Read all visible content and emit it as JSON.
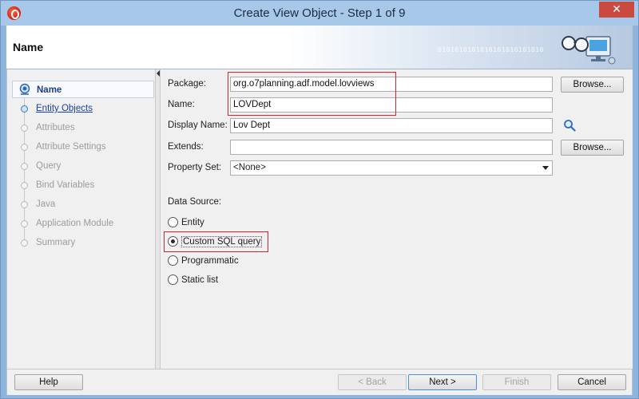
{
  "window": {
    "title": "Create View Object - Step 1 of 9",
    "close_glyph": "✕",
    "header_title": "Name",
    "binary_text": "0101010101010101010101010",
    "app_icon": "oracle-jdeveloper-icon"
  },
  "nav": {
    "items": [
      {
        "label": "Name",
        "state": "active"
      },
      {
        "label": "Entity Objects",
        "state": "link"
      },
      {
        "label": "Attributes",
        "state": "disabled"
      },
      {
        "label": "Attribute Settings",
        "state": "disabled"
      },
      {
        "label": "Query",
        "state": "disabled"
      },
      {
        "label": "Bind Variables",
        "state": "disabled"
      },
      {
        "label": "Java",
        "state": "disabled"
      },
      {
        "label": "Application Module",
        "state": "disabled"
      },
      {
        "label": "Summary",
        "state": "disabled"
      }
    ]
  },
  "form": {
    "package_label": "Package:",
    "package_value": "org.o7planning.adf.model.lovviews",
    "name_label": "Name:",
    "name_value": "LOVDept",
    "display_name_label": "Display Name:",
    "display_name_value": "Lov Dept",
    "extends_label": "Extends:",
    "extends_value": "",
    "property_set_label": "Property Set:",
    "property_set_value": "<None>",
    "browse_label": "Browse...",
    "data_source_label": "Data Source:",
    "data_source_options": [
      {
        "label": "Entity",
        "selected": false
      },
      {
        "label": "Custom SQL query",
        "selected": true
      },
      {
        "label": "Programmatic",
        "selected": false
      },
      {
        "label": "Static list",
        "selected": false
      }
    ]
  },
  "footer": {
    "help": "Help",
    "back": "< Back",
    "next": "Next >",
    "finish": "Finish",
    "cancel": "Cancel"
  },
  "colors": {
    "highlight": "#d9232a",
    "link": "#1a3fa3",
    "title_bar": "#a8c8ea",
    "close_button": "#c94a3f"
  }
}
